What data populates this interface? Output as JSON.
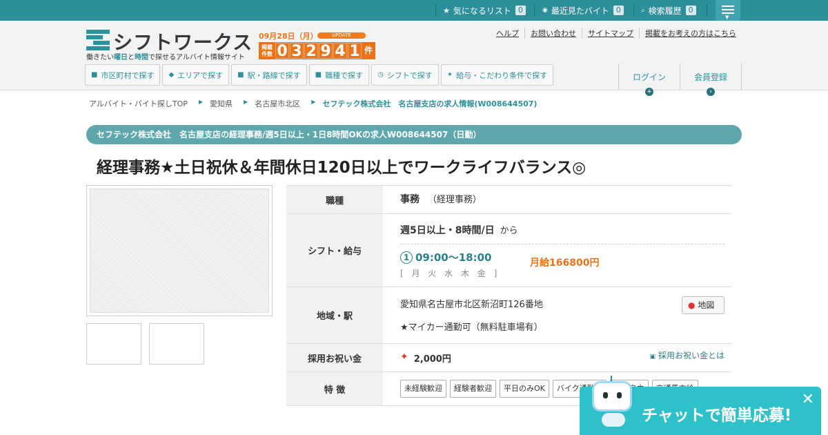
{
  "topbar": {
    "fav_label": "気になるリスト",
    "fav_count": "0",
    "recent_label": "最近見たバイト",
    "recent_count": "0",
    "history_label": "検索履歴",
    "history_count": "0"
  },
  "header": {
    "logo_text": "シフトワークス",
    "tagline_pre": "働きたい",
    "tagline_day": "曜日",
    "tagline_and": "と",
    "tagline_time": "時間",
    "tagline_post": "で探せるアルバイト情報サイト",
    "date": "09月28日（月）",
    "update_badge": "UPDATE",
    "count_label": "掲載件数",
    "count_digits": [
      "0",
      "3",
      "2",
      "9",
      "4",
      "1"
    ],
    "count_unit": "件",
    "links": [
      "ヘルプ",
      "お問い合わせ",
      "サイトマップ",
      "掲載をお考えの方はこちら"
    ]
  },
  "nav": {
    "items": [
      {
        "icon": "■",
        "label": "市区町村で探す"
      },
      {
        "icon": "◆",
        "label": "エリアで探す"
      },
      {
        "icon": "■",
        "label": "駅・路線で探す"
      },
      {
        "icon": "■",
        "label": "職種で探す"
      },
      {
        "icon": "◷",
        "label": "シフトで探す"
      },
      {
        "icon": "✦",
        "label": "給与・こだわり条件で探す"
      }
    ],
    "login": "ログイン",
    "register": "会員登録"
  },
  "breadcrumb": [
    "アルバイト・バイト探しTOP",
    "愛知県",
    "名古屋市北区",
    "セフテック株式会社　名古屋支店の求人情報(W008644507)"
  ],
  "job": {
    "banner": "セフテック株式会社　名古屋支店の経理事務/週5日以上・1日8時間OKの求人W008644507（日勤）",
    "title": "経理事務★土日祝休＆年間休日120日以上でワークライフバランス◎",
    "labels": {
      "type": "職種",
      "shift": "シフト・給与",
      "area": "地域・駅",
      "bonus": "採用お祝い金",
      "features": "特 徴"
    },
    "type_main": "事務",
    "type_sub": "（経理事務）",
    "shift_main": "週5日以上・8時間/日",
    "shift_from": "から",
    "shift_num": "1",
    "shift_time": "09:00～18:00",
    "shift_days": "[ 月 火 水 木 金 ]",
    "salary": "月給166800円",
    "address": "愛知県名古屋市北区新沼町126番地",
    "parking": "★マイカー通勤可（無料駐車場有）",
    "map_button": "地図",
    "bonus_amount": "2,000円",
    "bonus_link": "採用お祝い金とは",
    "tags": [
      "未経験歓迎",
      "経験者歓迎",
      "平日のみOK",
      "バイク通勤可",
      "髪色自由",
      "交通費支給"
    ]
  },
  "chat": {
    "label": "チャットで簡単応募!",
    "close": "✕"
  }
}
